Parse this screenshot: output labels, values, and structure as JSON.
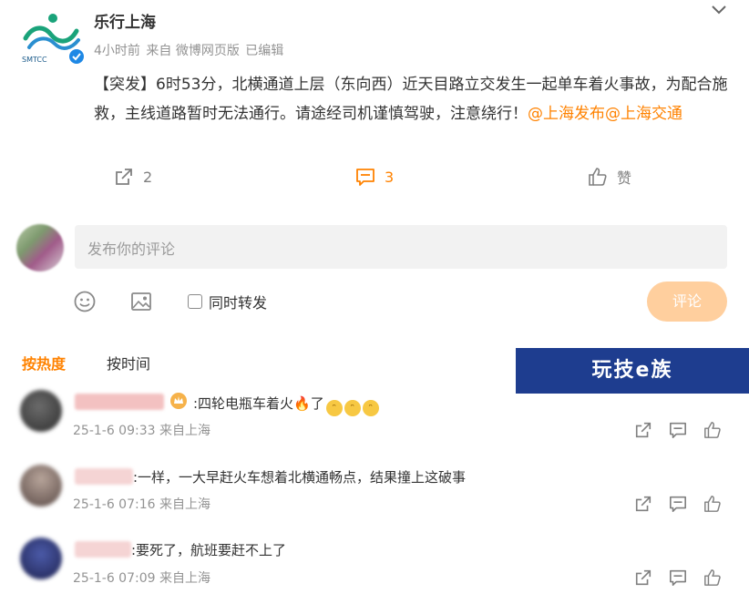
{
  "post": {
    "author": "乐行上海",
    "logo_text": "SMTCC",
    "time": "4小时前",
    "source": "来自 微博网页版",
    "edited": "已编辑",
    "body_prefix": "【突发】6时53分，北横通道上层（东向西）近天目路立交发生一起单车着火事故，为配合施救，主线道路暂时无法通行。请途经司机谨慎驾驶，注意绕行！",
    "mention1": "@上海发布",
    "mention2": "@上海交通",
    "repost_count": "2",
    "comment_count": "3",
    "like_label": "赞"
  },
  "composer": {
    "placeholder": "发布你的评论",
    "also_repost_label": "同时转发",
    "submit_label": "评论"
  },
  "sort_tabs": {
    "hot": "按热度",
    "time": "按时间"
  },
  "watermark": "玩技e族",
  "comments": [
    {
      "text": ":四轮电瓶车着火",
      "after_fire": "了",
      "time": "25-1-6 09:33",
      "source": "来自上海"
    },
    {
      "text": ":一样，一大早赶火车想着北横通畅点，结果撞上这破事",
      "time": "25-1-6 07:16",
      "source": "来自上海"
    },
    {
      "text": ":要死了，航班要赶不上了",
      "time": "25-1-6 07:09",
      "source": "来自上海"
    }
  ],
  "colors": {
    "accent": "#ff8200",
    "muted": "#939393",
    "submit_disabled": "#ffcf9e"
  }
}
